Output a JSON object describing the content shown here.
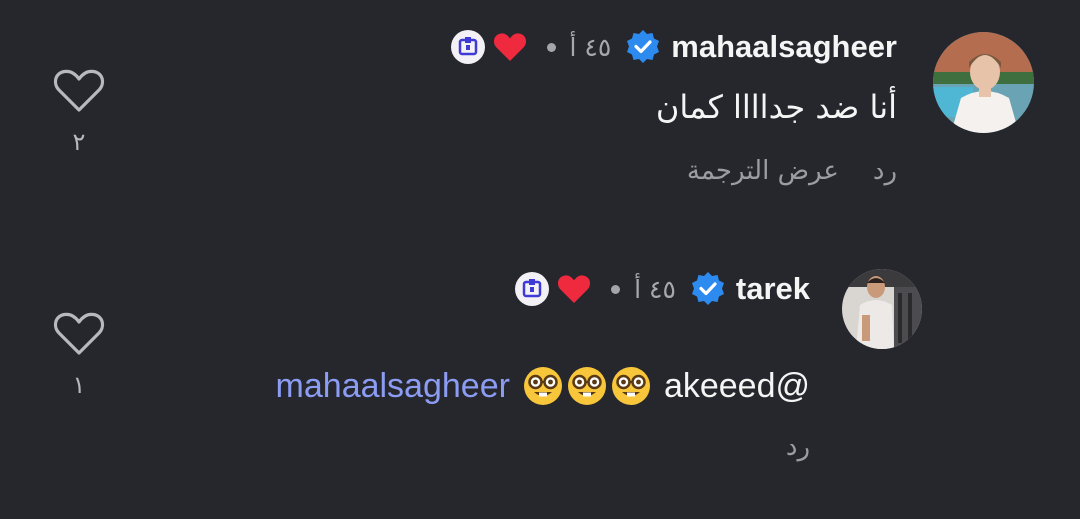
{
  "colors": {
    "background": "#25272d",
    "liked_heart": "#ef2a3f",
    "verified_badge": "#2d8bf0",
    "mention": "#8c9cf3",
    "meta_text": "#a7a7ae"
  },
  "comments": [
    {
      "username": "mahaalsagheer",
      "verified": true,
      "time": "٤٥ أ",
      "creator_liked": true,
      "text": "أنا ضد جداااا كمان",
      "actions": {
        "reply": "رد",
        "translate": "عرض الترجمة"
      },
      "like_count": "٢",
      "avatar_icon": "profile-photo-woman"
    },
    {
      "username": "tarek",
      "verified": true,
      "time": "٤٥ أ",
      "creator_liked": true,
      "text_prefix": "@akeeed",
      "emojis": [
        "nerd-face",
        "nerd-face",
        "nerd-face"
      ],
      "mention": "mahaalsagheer",
      "actions": {
        "reply": "رد"
      },
      "like_count": "١",
      "avatar_icon": "profile-photo-man"
    }
  ]
}
